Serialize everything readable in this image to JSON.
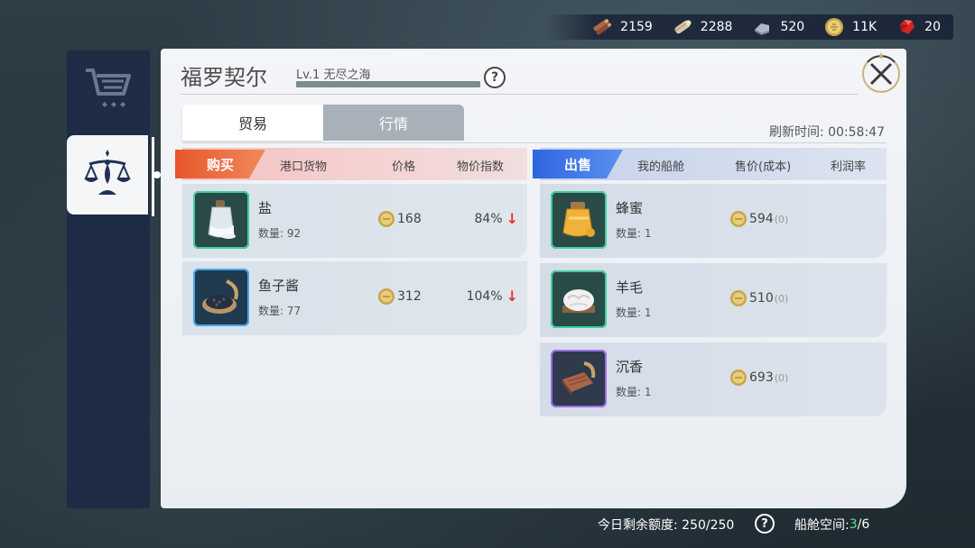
{
  "resources": [
    {
      "icon": "wood-icon",
      "value": "2159"
    },
    {
      "icon": "cloth-icon",
      "value": "2288"
    },
    {
      "icon": "iron-icon",
      "value": "520"
    },
    {
      "icon": "gold-coin-icon",
      "value": "11K"
    },
    {
      "icon": "red-gem-icon",
      "value": "20"
    }
  ],
  "rail": {
    "tabs": [
      {
        "icon": "shop-cart-icon",
        "active": false
      },
      {
        "icon": "trade-scales-icon",
        "active": true
      }
    ]
  },
  "panel": {
    "port_name": "福罗契尔",
    "level_text": "Lv.1 无尽之海",
    "help_label": "?",
    "tabs": [
      {
        "label": "贸易",
        "active": true
      },
      {
        "label": "行情",
        "active": false
      }
    ],
    "refresh_label": "刷新时间: 00:58:47"
  },
  "buy": {
    "ribbon": "购买",
    "col_goods": "港口货物",
    "col_price": "价格",
    "col_index": "物价指数",
    "items": [
      {
        "name": "盐",
        "qty": "数量: 92",
        "price": "168",
        "index": "84%",
        "trend": "↓",
        "rarity": "green",
        "icon": "salt-jar-icon"
      },
      {
        "name": "鱼子酱",
        "qty": "数量: 77",
        "price": "312",
        "index": "104%",
        "trend": "↓",
        "rarity": "blue",
        "icon": "caviar-dish-icon"
      }
    ]
  },
  "sell": {
    "ribbon": "出售",
    "col_cargo": "我的船舱",
    "col_price": "售价(成本)",
    "col_profit": "利润率",
    "items": [
      {
        "name": "蜂蜜",
        "qty": "数量: 1",
        "price": "594",
        "cost": "(0)",
        "rarity": "green",
        "icon": "honey-jar-icon"
      },
      {
        "name": "羊毛",
        "qty": "数量: 1",
        "price": "510",
        "cost": "(0)",
        "rarity": "green",
        "icon": "wool-bundle-icon"
      },
      {
        "name": "沉香",
        "qty": "数量: 1",
        "price": "693",
        "cost": "(0)",
        "rarity": "purple",
        "icon": "agarwood-icon"
      }
    ]
  },
  "footer": {
    "quota_label": "今日剩余额度: 250/250",
    "help_label": "?",
    "cargo_label": "船舱空间: ",
    "cargo_used": "3",
    "cargo_total": "/6"
  },
  "colors": {
    "buy_ribbon": "#e8562c",
    "sell_ribbon": "#2f66e0",
    "price_down": "#e83030",
    "cargo_used": "#5fe08a"
  }
}
